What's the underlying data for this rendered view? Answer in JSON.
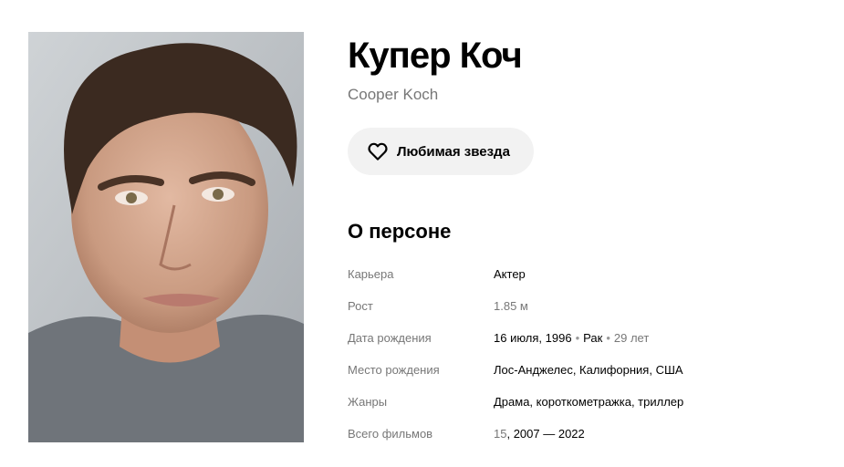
{
  "person": {
    "name_ru": "Купер Коч",
    "name_original": "Cooper Koch",
    "photo_icon": "person-photo"
  },
  "favorite_button": {
    "label": "Любимая звезда",
    "icon": "heart-icon"
  },
  "about": {
    "title": "О персоне",
    "career": {
      "label": "Карьера",
      "value": "Актер"
    },
    "height": {
      "label": "Рост",
      "value": "1.85 м"
    },
    "birth_date": {
      "label": "Дата рождения",
      "date": "16 июля, 1996",
      "sign": "Рак",
      "age": "29 лет"
    },
    "birth_place": {
      "label": "Место рождения",
      "value": "Лос-Анджелес, Калифорния, США"
    },
    "genres": {
      "label": "Жанры",
      "value": "Драма, короткометражка, триллер"
    },
    "total_films": {
      "label": "Всего фильмов",
      "count": "15",
      "years": ", 2007 — 2022"
    }
  },
  "colors": {
    "button_bg": "#f2f2f2",
    "muted_text": "#777777"
  }
}
